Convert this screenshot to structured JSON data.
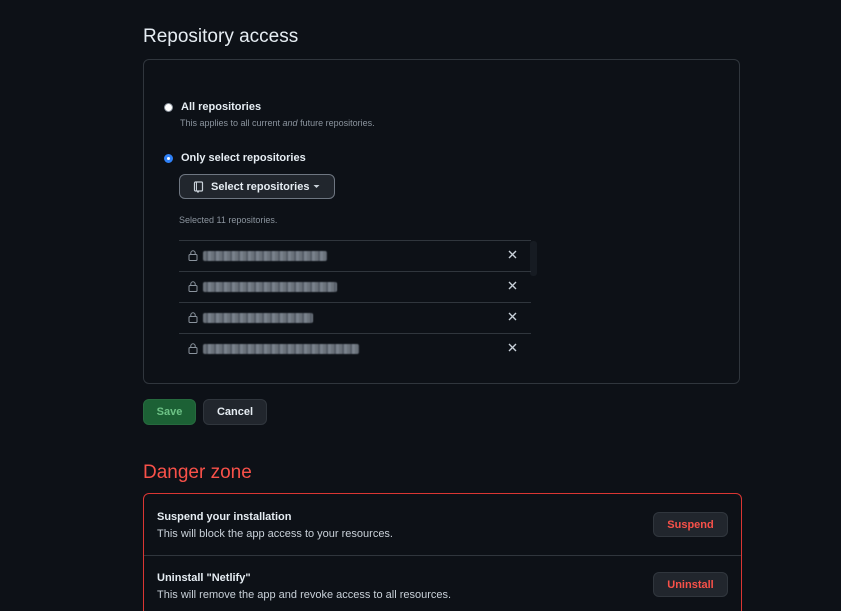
{
  "repository_access": {
    "title": "Repository access",
    "options": [
      {
        "label": "All repositories",
        "help_prefix": "This applies to all current ",
        "help_emphasis": "and",
        "help_suffix": " future repositories.",
        "checked": false
      },
      {
        "label": "Only select repositories",
        "checked": true
      }
    ],
    "select_button": {
      "label": "Select repositories",
      "icon": "repo-icon",
      "caret_icon": "caret-down-icon"
    },
    "selected_count_text": "Selected 11 repositories.",
    "repositories": [
      {
        "name": "",
        "lock_icon": "lock-icon",
        "remove_icon": "x-icon"
      },
      {
        "name": "",
        "lock_icon": "lock-icon",
        "remove_icon": "x-icon"
      },
      {
        "name": "",
        "lock_icon": "lock-icon",
        "remove_icon": "x-icon"
      },
      {
        "name": "",
        "lock_icon": "lock-icon",
        "remove_icon": "x-icon"
      }
    ]
  },
  "actions": {
    "save_label": "Save",
    "cancel_label": "Cancel"
  },
  "danger_zone": {
    "title": "Danger zone",
    "items": [
      {
        "title": "Suspend your installation",
        "description": "This will block the app access to your resources.",
        "button_label": "Suspend"
      },
      {
        "title": "Uninstall \"Netlify\"",
        "description": "This will remove the app and revoke access to all resources.",
        "button_label": "Uninstall"
      }
    ]
  },
  "colors": {
    "background": "#0d1117",
    "border": "#30363d",
    "accent_blue": "#2f81f7",
    "danger_red": "#f85149",
    "save_green": "#1f6f3b"
  }
}
